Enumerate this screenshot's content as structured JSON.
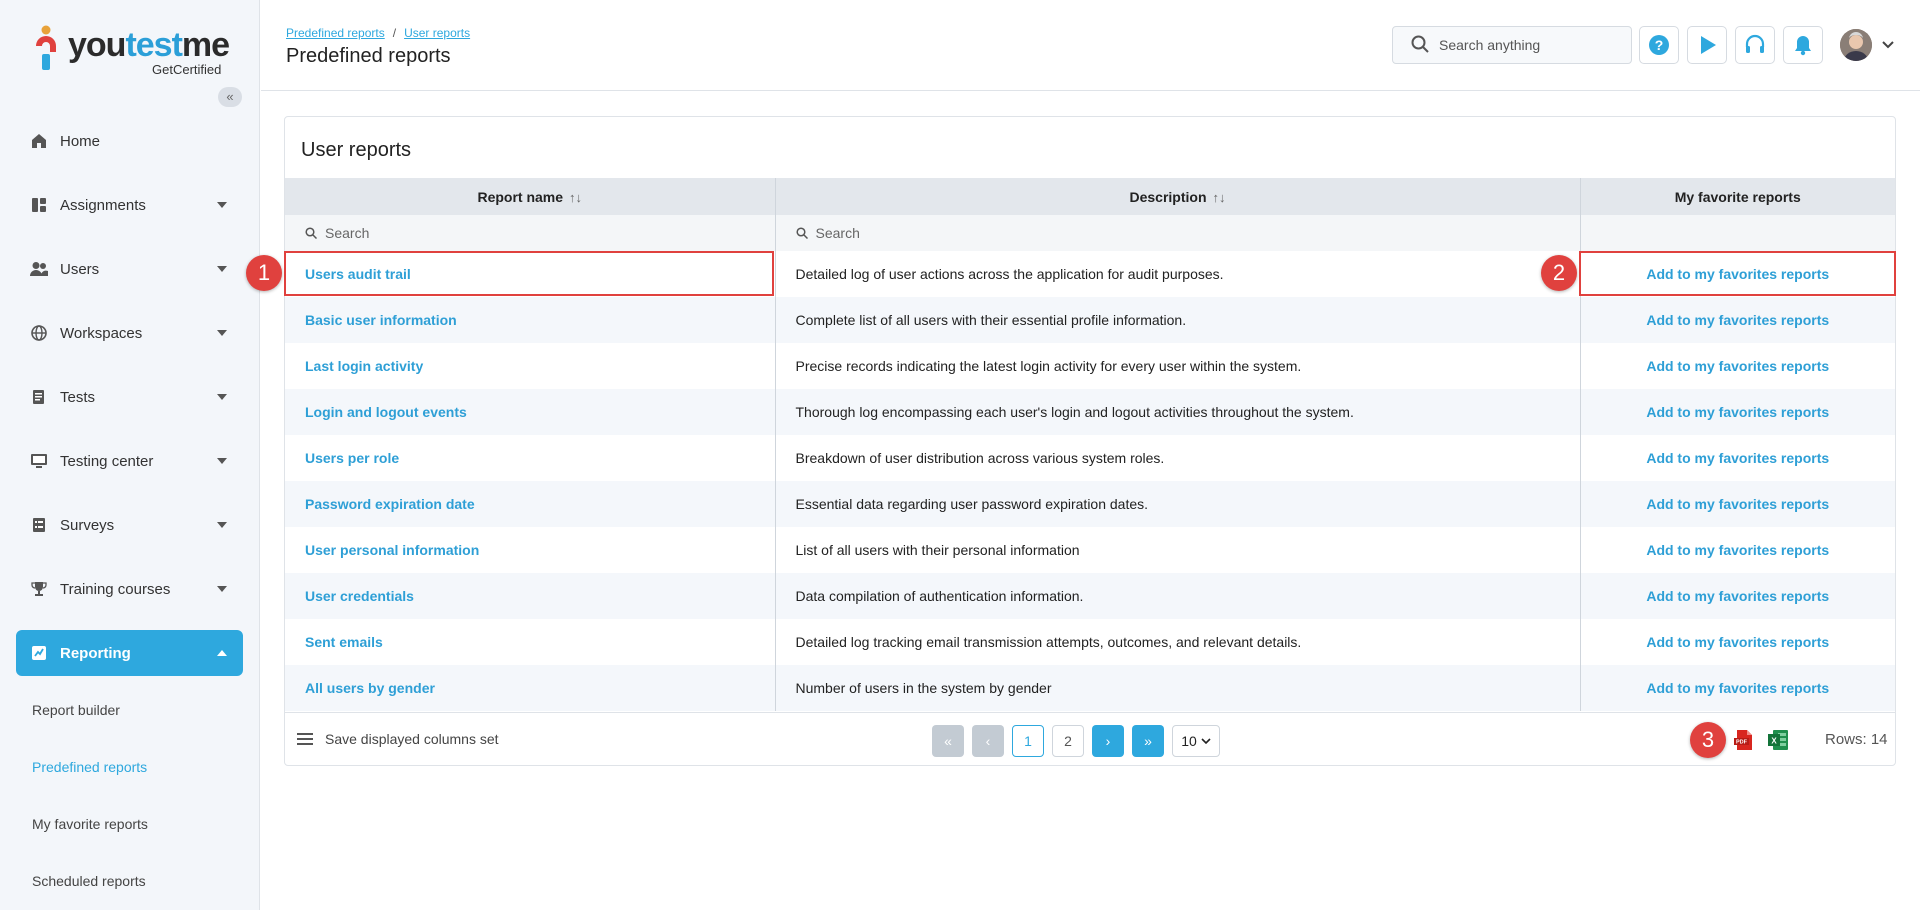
{
  "brand": {
    "name_part1": "you",
    "name_part2": "test",
    "name_part3": "me",
    "tagline": "GetCertified",
    "accent": "#2ea8de"
  },
  "sidebar": {
    "collapse_icon": "double-chevron-left-icon",
    "items": [
      {
        "label": "Home",
        "icon": "home-icon"
      },
      {
        "label": "Assignments",
        "icon": "assignments-icon"
      },
      {
        "label": "Users",
        "icon": "users-icon"
      },
      {
        "label": "Workspaces",
        "icon": "globe-icon"
      },
      {
        "label": "Tests",
        "icon": "tests-icon"
      },
      {
        "label": "Testing center",
        "icon": "monitor-icon"
      },
      {
        "label": "Surveys",
        "icon": "survey-icon"
      },
      {
        "label": "Training courses",
        "icon": "trophy-icon"
      },
      {
        "label": "Reporting",
        "icon": "chart-icon"
      }
    ],
    "sub_items": [
      {
        "label": "Report builder"
      },
      {
        "label": "Predefined reports"
      },
      {
        "label": "My favorite reports"
      },
      {
        "label": "Scheduled reports"
      }
    ]
  },
  "header": {
    "breadcrumb": [
      "Predefined reports",
      "User reports"
    ],
    "breadcrumb_sep": "/",
    "title": "Predefined reports",
    "search_placeholder": "Search anything"
  },
  "card": {
    "title": "User reports",
    "columns": {
      "name": "Report name",
      "description": "Description",
      "favorites": "My favorite reports"
    },
    "sort_glyph": "↑↓",
    "filter_placeholder": "Search",
    "rows": [
      {
        "name": "Users audit trail",
        "description": "Detailed log of user actions across the application for audit purposes.",
        "action": "Add to my favorites reports"
      },
      {
        "name": "Basic user information",
        "description": "Complete list of all users with their essential profile information.",
        "action": "Add to my favorites reports"
      },
      {
        "name": "Last login activity",
        "description": "Precise records indicating the latest login activity for every user within the system.",
        "action": "Add to my favorites reports"
      },
      {
        "name": "Login and logout events",
        "description": "Thorough log encompassing each user's login and logout activities throughout the system.",
        "action": "Add to my favorites reports"
      },
      {
        "name": "Users per role",
        "description": "Breakdown of user distribution across various system roles.",
        "action": "Add to my favorites reports"
      },
      {
        "name": "Password expiration date",
        "description": "Essential data regarding user password expiration dates.",
        "action": "Add to my favorites reports"
      },
      {
        "name": "User personal information",
        "description": "List of all users with their personal information",
        "action": "Add to my favorites reports"
      },
      {
        "name": "User credentials",
        "description": "Data compilation of authentication information.",
        "action": "Add to my favorites reports"
      },
      {
        "name": "Sent emails",
        "description": "Detailed log tracking email transmission attempts, outcomes, and relevant details.",
        "action": "Add to my favorites reports"
      },
      {
        "name": "All users by gender",
        "description": "Number of users in the system by gender",
        "action": "Add to my favorites reports"
      }
    ]
  },
  "footer": {
    "save_columns": "Save displayed columns set",
    "pages": [
      "1",
      "2"
    ],
    "page_size": "10",
    "rows_label": "Rows: 14"
  },
  "annotations": {
    "m1": "1",
    "m2": "2",
    "m3": "3"
  }
}
